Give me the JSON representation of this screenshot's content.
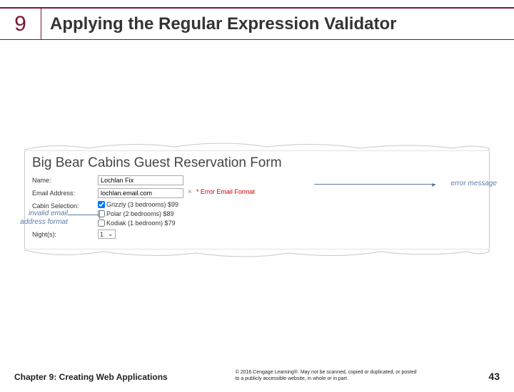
{
  "header": {
    "chapter_number": "9",
    "title": "Applying the Regular Expression Validator"
  },
  "figure": {
    "form_title": "Big Bear Cabins Guest Reservation Form",
    "labels": {
      "name": "Name:",
      "email": "Email Address:",
      "cabin": "Cabin Selection:",
      "nights": "Night(s):"
    },
    "values": {
      "name": "Lochlan Fix",
      "email": "lochlan.email.com",
      "nights": "1"
    },
    "cabins": {
      "grizzly": "Grizzly (3 bedrooms) $99",
      "polar": "Polar (2 bedrooms) $89",
      "kodiak": "Kodiak (1 bedroom) $79"
    },
    "error_text": "* Error Email Format"
  },
  "callouts": {
    "left": "invalid email\naddress format",
    "right": "error message"
  },
  "footer": {
    "chapter": "Chapter 9: Creating Web Applications",
    "copyright": "© 2016 Cengage Learning®. May not be scanned, copied or duplicated, or posted to a publicly accessible website, in whole or in part.",
    "page": "43"
  }
}
